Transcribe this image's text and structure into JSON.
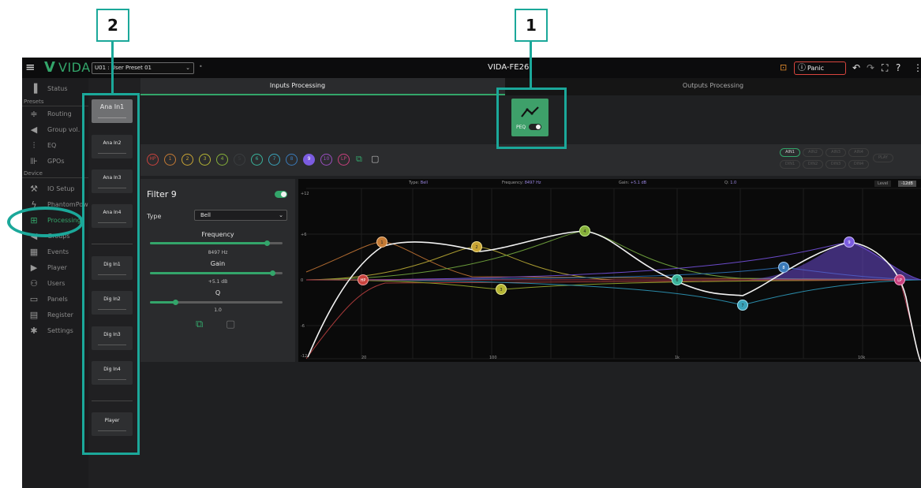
{
  "topbar": {
    "brand_letter": "V",
    "brand_name": "VIDA",
    "preset_value": "U01 : User Preset 01",
    "device_title": "VIDA-FE26",
    "panic_label": "Panic"
  },
  "nav": {
    "items": [
      {
        "label": "Status",
        "icon": "bar-chart-icon"
      },
      {
        "label": "Routing",
        "icon": "routing-icon"
      },
      {
        "label": "Group vol.",
        "icon": "speaker-icon"
      },
      {
        "label": "EQ",
        "icon": "eq-sliders-icon"
      },
      {
        "label": "GPOs",
        "icon": "gpo-icon"
      },
      {
        "label": "IO Setup",
        "icon": "wrench-icon"
      },
      {
        "label": "PhantomPower",
        "icon": "phantom-power-icon"
      },
      {
        "label": "Processing",
        "icon": "processing-chip-icon"
      },
      {
        "label": "Groups",
        "icon": "groups-icon"
      },
      {
        "label": "Events",
        "icon": "calendar-icon"
      },
      {
        "label": "Player",
        "icon": "play-icon"
      },
      {
        "label": "Users",
        "icon": "users-icon"
      },
      {
        "label": "Panels",
        "icon": "panels-icon"
      },
      {
        "label": "Register",
        "icon": "register-icon"
      },
      {
        "label": "Settings",
        "icon": "gear-icon"
      }
    ],
    "section_presets": "Presets",
    "section_device": "Device"
  },
  "channels": [
    "Ana In1",
    "Ana In2",
    "Ana In3",
    "Ana In4",
    "Dig In1",
    "Dig In2",
    "Dig In3",
    "Dig In4",
    "Player"
  ],
  "tabs": {
    "inputs": "Inputs Processing",
    "outputs": "Outputs Processing"
  },
  "peq_block": {
    "label": "PEQ",
    "enabled": true
  },
  "filter_buttons": [
    "HP",
    "1",
    "2",
    "3",
    "4",
    "5",
    "6",
    "7",
    "8",
    "9",
    "10",
    "LP"
  ],
  "ain_pills": [
    "AIN1",
    "AIN2",
    "AIN3",
    "AIN4",
    "DIN1",
    "DIN2",
    "DIN3",
    "DIN4",
    "PLAY"
  ],
  "filter_panel": {
    "title": "Filter 9",
    "enabled": true,
    "type_label": "Type",
    "type_value": "Bell",
    "frequency_label": "Frequency",
    "frequency_value": "8497 Hz",
    "frequency_position": 0.88,
    "gain_label": "Gain",
    "gain_value": "+5.1 dB",
    "gain_position": 0.92,
    "q_label": "Q",
    "q_value": "1.0",
    "q_position": 0.19
  },
  "graph": {
    "type_label": "Type:",
    "type_value": "Bell",
    "freq_label": "Frequency:",
    "freq_value": "8497 Hz",
    "gain_label": "Gain:",
    "gain_value": "+5.1 dB",
    "q_label": "Q:",
    "q_value": "1.0",
    "level_label": "Level",
    "level_value": "-12dB",
    "y_ticks": [
      "+12",
      "+6",
      "0",
      "-6",
      "-12"
    ],
    "x_ticks": [
      "20",
      "100",
      "1k",
      "10k"
    ]
  },
  "callouts": [
    "1",
    "2"
  ],
  "colors": {
    "accent": "#33a56a",
    "callout": "#1ba89a",
    "panic": "#d8453e",
    "selected_filter": "#7b5ce0"
  }
}
